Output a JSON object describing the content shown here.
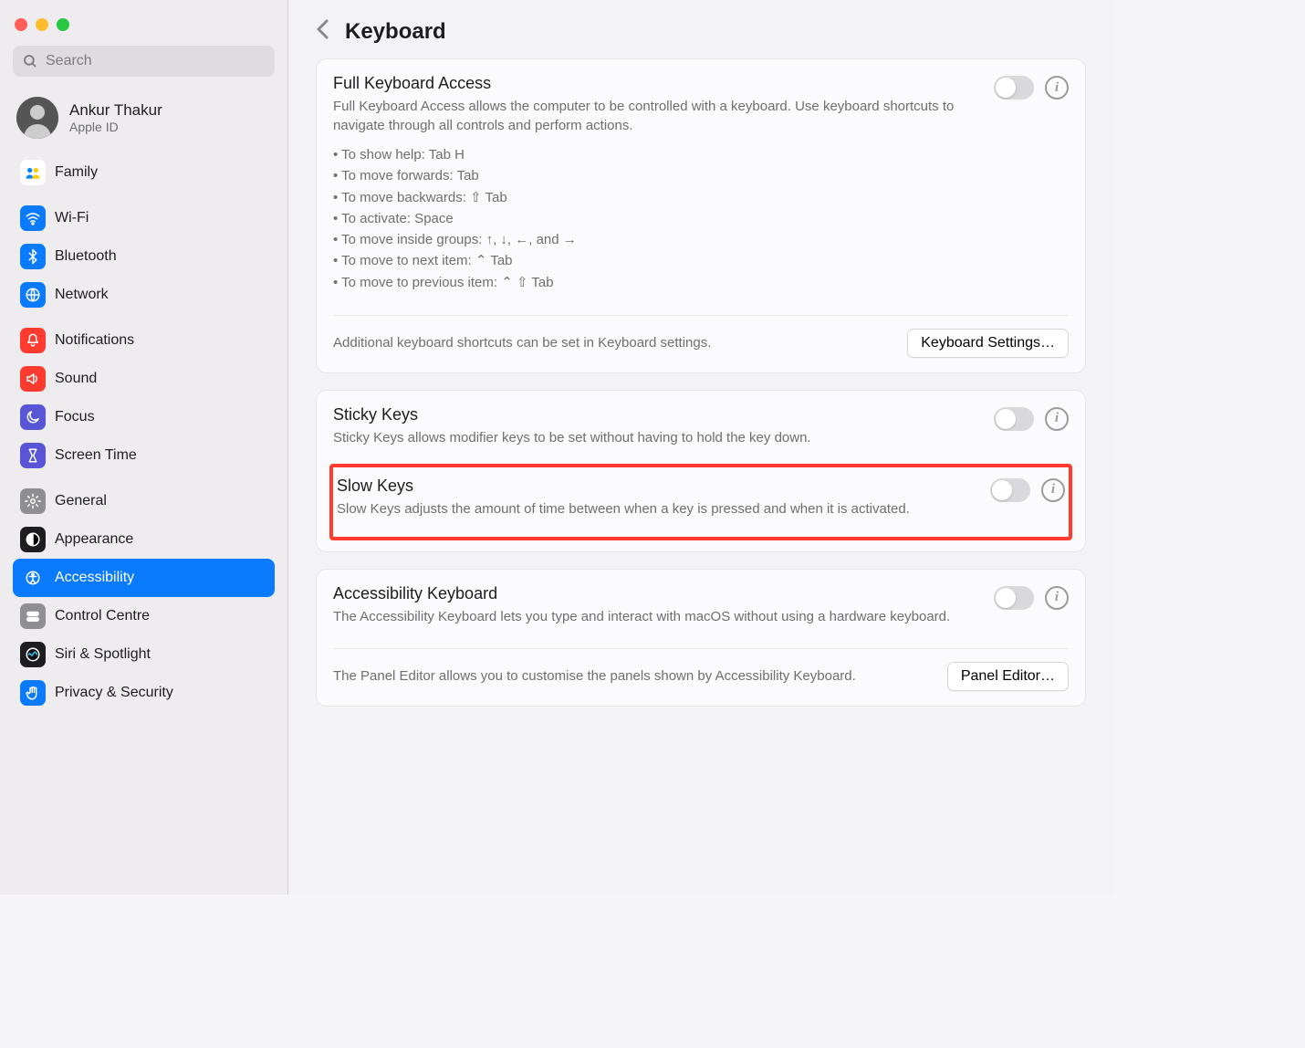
{
  "search": {
    "placeholder": "Search"
  },
  "user": {
    "name": "Ankur Thakur",
    "sub": "Apple ID"
  },
  "sidebar": {
    "family": "Family",
    "items1": [
      {
        "label": "Wi-Fi",
        "bg": "#0a7aff",
        "glyph": "wifi"
      },
      {
        "label": "Bluetooth",
        "bg": "#0a7aff",
        "glyph": "bt"
      },
      {
        "label": "Network",
        "bg": "#0a7aff",
        "glyph": "globe"
      }
    ],
    "items2": [
      {
        "label": "Notifications",
        "bg": "#ff3b30",
        "glyph": "bell"
      },
      {
        "label": "Sound",
        "bg": "#ff3b30",
        "glyph": "sound"
      },
      {
        "label": "Focus",
        "bg": "#5856d6",
        "glyph": "moon"
      },
      {
        "label": "Screen Time",
        "bg": "#5856d6",
        "glyph": "hour"
      }
    ],
    "items3": [
      {
        "label": "General",
        "bg": "#8e8e93",
        "glyph": "gear"
      },
      {
        "label": "Appearance",
        "bg": "#1d1d1f",
        "glyph": "appear"
      },
      {
        "label": "Accessibility",
        "bg": "#0a7aff",
        "glyph": "access",
        "selected": true
      },
      {
        "label": "Control Centre",
        "bg": "#8e8e93",
        "glyph": "ctrlc"
      },
      {
        "label": "Siri & Spotlight",
        "bg": "#1d1d1f",
        "glyph": "siri"
      },
      {
        "label": "Privacy & Security",
        "bg": "#0a7aff",
        "glyph": "hand"
      }
    ]
  },
  "header": {
    "title": "Keyboard"
  },
  "full_kb": {
    "title": "Full Keyboard Access",
    "desc": "Full Keyboard Access allows the computer to be controlled with a keyboard. Use keyboard shortcuts to navigate through all controls and perform actions.",
    "shortcuts": [
      "To show help: Tab H",
      "To move forwards: Tab",
      "To move backwards: ⇧ Tab",
      "To activate: Space",
      "To move inside groups: ↑, ↓, ←, and →",
      "To move to next item: ⌃ Tab",
      "To move to previous item: ⌃ ⇧ Tab"
    ],
    "extra_desc": "Additional keyboard shortcuts can be set in Keyboard settings.",
    "button": "Keyboard Settings…"
  },
  "sticky": {
    "title": "Sticky Keys",
    "desc": "Sticky Keys allows modifier keys to be set without having to hold the key down."
  },
  "slow": {
    "title": "Slow Keys",
    "desc": "Slow Keys adjusts the amount of time between when a key is pressed and when it is activated."
  },
  "akbd": {
    "title": "Accessibility Keyboard",
    "desc": "The Accessibility Keyboard lets you type and interact with macOS without using a hardware keyboard.",
    "panel_desc": "The Panel Editor allows you to customise the panels shown by Accessibility Keyboard.",
    "panel_button": "Panel Editor…"
  }
}
